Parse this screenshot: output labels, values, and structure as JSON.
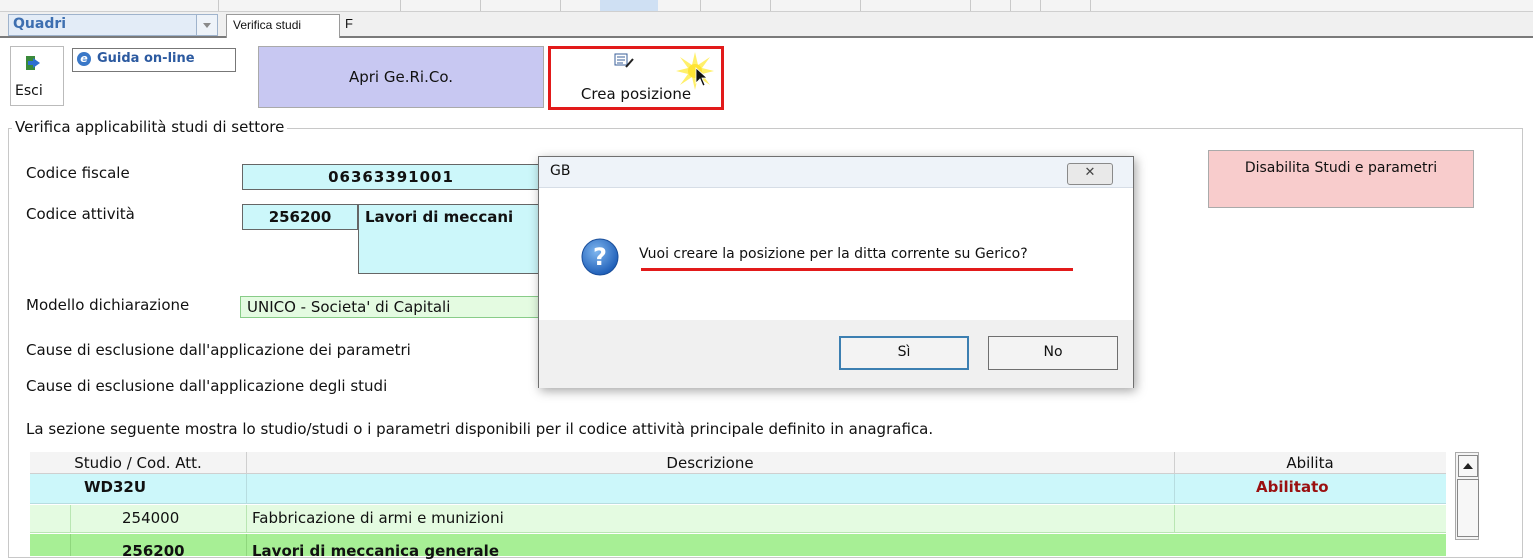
{
  "tabbar": {
    "combo_value": "Quadri",
    "active_tab": "Verifica studi",
    "next_tab": "F"
  },
  "toolbar": {
    "esci_label": "Esci",
    "guida_label": "Guida on-line",
    "apri_label": "Apri Ge.Ri.Co.",
    "crea_label": "Crea posizione"
  },
  "section": {
    "title": "Verifica applicabilità studi di settore",
    "codice_fiscale_label": "Codice fiscale",
    "codice_fiscale_value": "06363391001",
    "codice_attivita_label": "Codice attività",
    "codice_attivita_code": "256200",
    "codice_attivita_desc": "Lavori di meccani",
    "modello_label": "Modello dichiarazione",
    "modello_value": "UNICO - Societa' di Capitali",
    "cause_parametri_label": "Cause di esclusione dall'applicazione dei parametri",
    "cause_studi_label": "Cause di esclusione dall'applicazione degli studi",
    "info_text": "La sezione seguente mostra lo studio/studi o i parametri disponibili per il codice attività principale definito in anagrafica.",
    "disabilita_label": "Disabilita Studi e parametri"
  },
  "table": {
    "headers": [
      "Studio / Cod. Att.",
      "Descrizione",
      "Abilita"
    ],
    "rows": [
      {
        "code": "WD32U",
        "desc": "",
        "abilita": "Abilitato"
      },
      {
        "code": "254000",
        "desc": "Fabbricazione di armi e munizioni",
        "abilita": ""
      },
      {
        "code": "256200",
        "desc": "Lavori di meccanica generale",
        "abilita": ""
      }
    ]
  },
  "dialog": {
    "title": "GB",
    "close_glyph": "✕",
    "message": "Vuoi creare la posizione per la ditta corrente su Gerico?",
    "yes_label": "Sì",
    "no_label": "No"
  },
  "colors": {
    "accent_red": "#e21a1a",
    "field_cyan": "#ccf7fa",
    "field_green": "#e4fbe1",
    "row_highlight": "#a7ef95",
    "apri_bg": "#c8c8f2",
    "disabilita_bg": "#f8cccc",
    "abilitato_text": "#9a1010"
  }
}
